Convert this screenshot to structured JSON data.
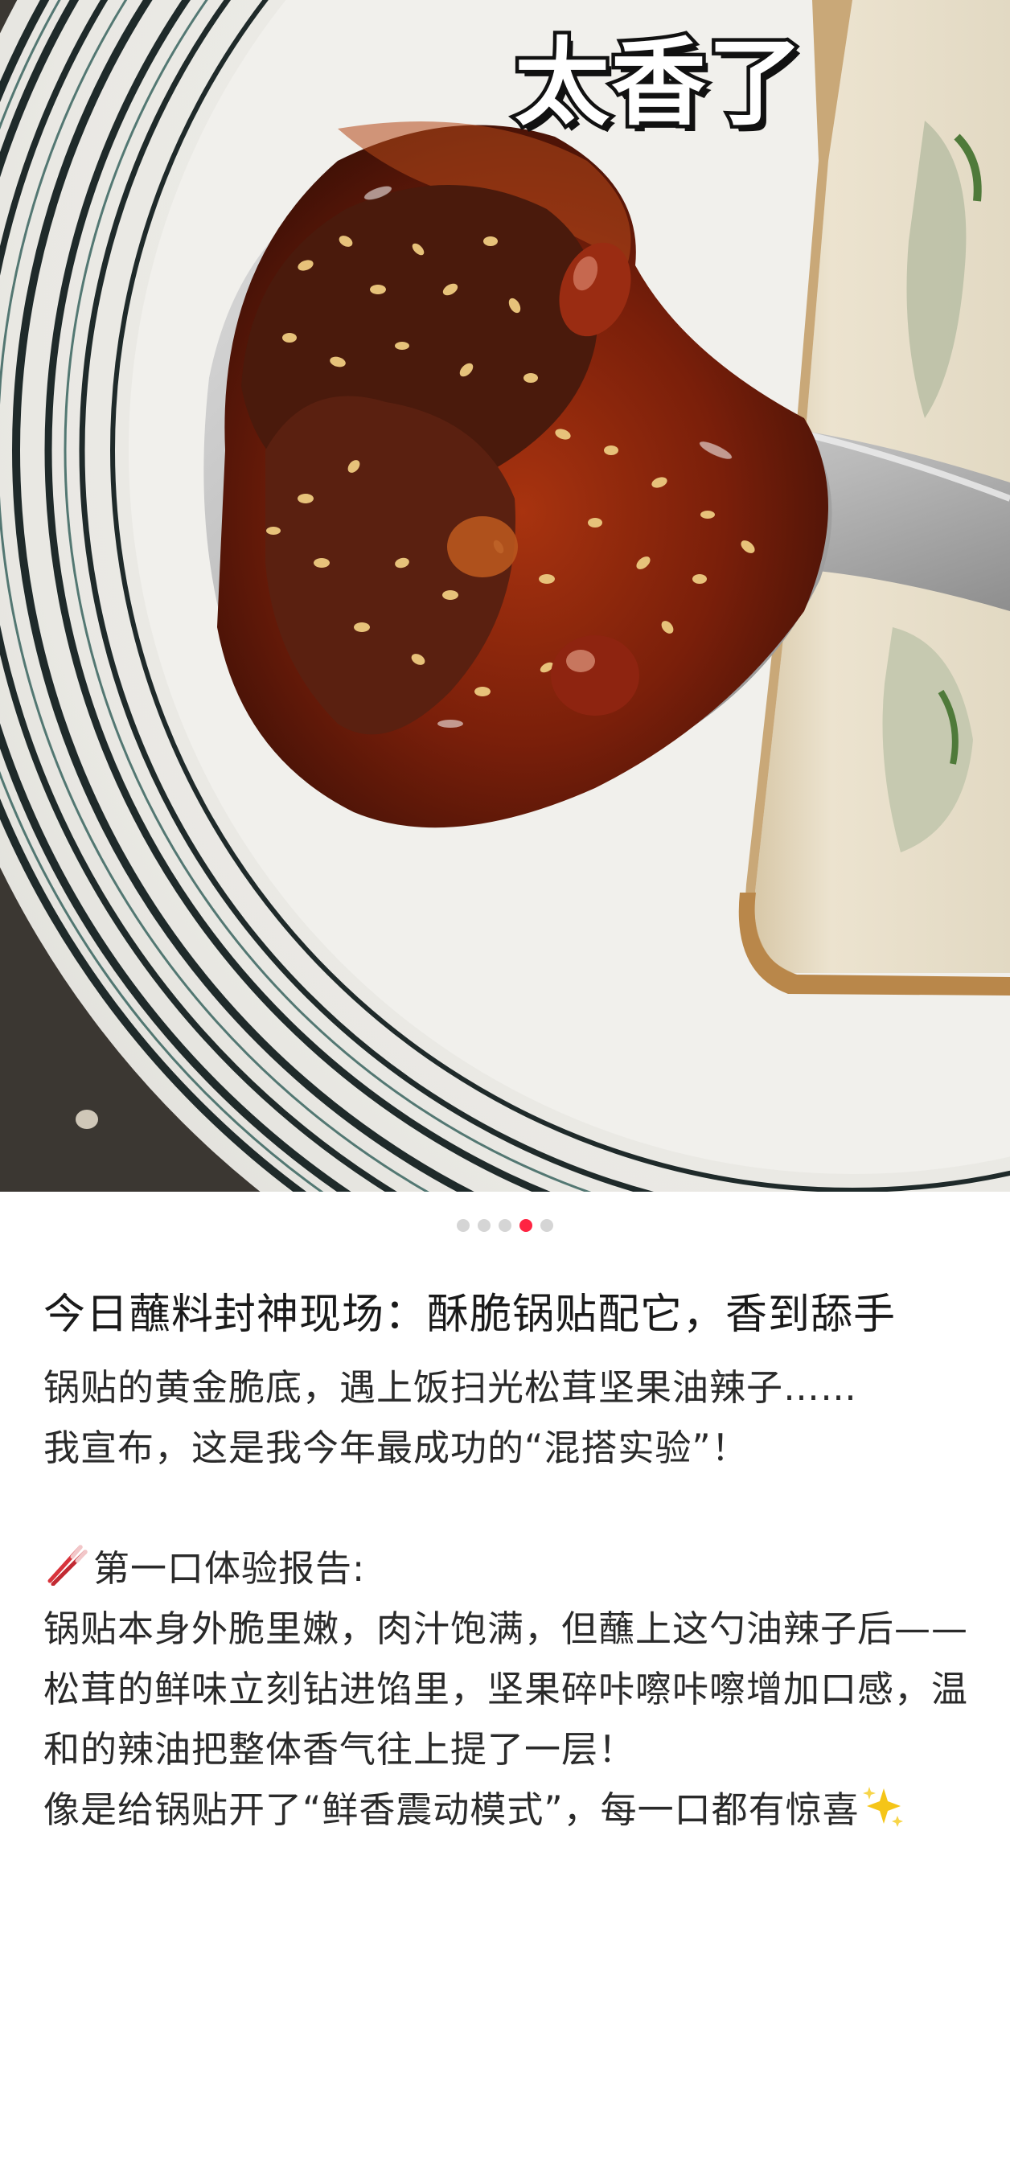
{
  "hero": {
    "overlay_caption": "太香了",
    "photo_icon": "chili-oil-spoon-photo"
  },
  "pagination": {
    "total": 5,
    "active_index": 3,
    "active_color": "#ff2442",
    "inactive_color": "#d5d5d5"
  },
  "note": {
    "title": "今日蘸料封神现场：酥脆锅贴配它，香到舔手",
    "paragraphs": {
      "p1": "锅贴的黄金脆底，遇上饭扫光松茸坚果油辣子……",
      "p2": "我宣布，这是我今年最成功的“混搭实验”！",
      "p3_heading": "第一口体验报告:",
      "p4": "锅贴本身外脆里嫩，肉汁饱满，但蘸上这勺油辣子后——",
      "p5": "松茸的鲜味立刻钻进馅里，坚果碎咔嚓咔嚓增加口感，温和的辣油把整体香气往上提了一层！",
      "p6": "像是给锅贴开了“鲜香震动模式”，每一口都有惊喜"
    },
    "icons": {
      "heading_icon": "chopsticks-icon",
      "ending_icon": "sparkles-icon"
    }
  }
}
